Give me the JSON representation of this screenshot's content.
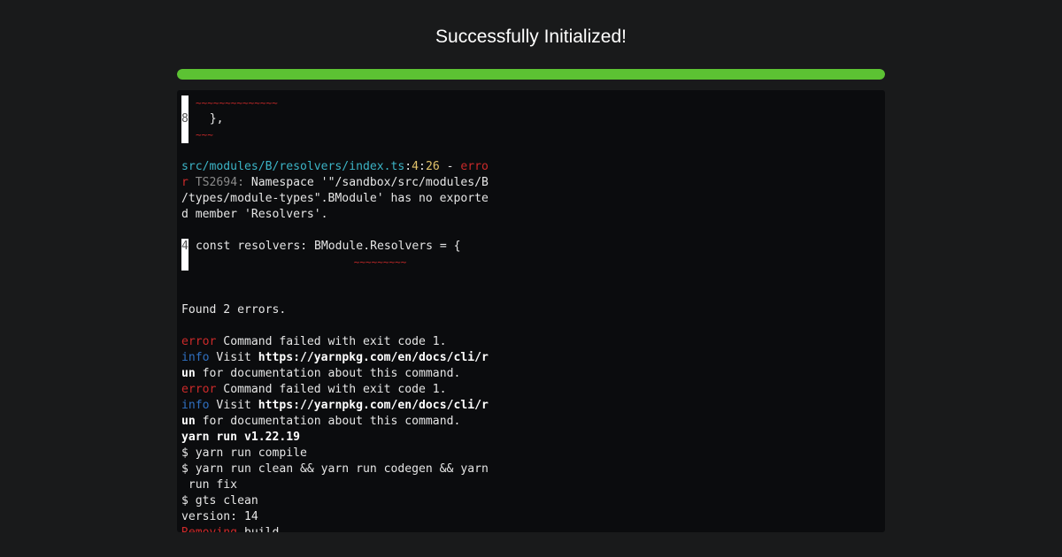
{
  "page": {
    "title": "Successfully Initialized!"
  },
  "progress": {
    "percent": 100,
    "color": "#5cc233"
  },
  "terminal": {
    "lines": [
      {
        "gutter": " ",
        "segments": [
          {
            "t": "~~~~~~~~~~~~~~",
            "c": "squig"
          }
        ]
      },
      {
        "gutter": "8",
        "segments": [
          {
            "t": "  },",
            "c": ""
          }
        ]
      },
      {
        "gutter": " ",
        "segments": [
          {
            "t": "~~~",
            "c": "squig"
          }
        ]
      },
      {
        "segments": [
          {
            "t": "",
            "c": ""
          }
        ]
      },
      {
        "segments": [
          {
            "t": "src/modules/B/resolvers/index.ts",
            "c": "cyan"
          },
          {
            "t": ":",
            "c": ""
          },
          {
            "t": "4",
            "c": "yellow"
          },
          {
            "t": ":",
            "c": ""
          },
          {
            "t": "26",
            "c": "yellow"
          },
          {
            "t": " - ",
            "c": ""
          },
          {
            "t": "erro",
            "c": "red"
          }
        ]
      },
      {
        "segments": [
          {
            "t": "r",
            "c": "red"
          },
          {
            "t": " TS2694:",
            "c": "grey"
          },
          {
            "t": " Namespace '\"/sandbox/src/modules/B",
            "c": ""
          }
        ]
      },
      {
        "segments": [
          {
            "t": "/types/module-types\".BModule' has no exporte",
            "c": ""
          }
        ]
      },
      {
        "segments": [
          {
            "t": "d member 'Resolvers'.",
            "c": ""
          }
        ]
      },
      {
        "segments": [
          {
            "t": "",
            "c": ""
          }
        ]
      },
      {
        "gutter": "4",
        "segments": [
          {
            "t": "const resolvers: BModule.Resolvers = {",
            "c": ""
          }
        ]
      },
      {
        "gutter": " ",
        "segments": [
          {
            "t": "                           ~~~~~~~~~",
            "c": "squig"
          }
        ]
      },
      {
        "segments": [
          {
            "t": "",
            "c": ""
          }
        ]
      },
      {
        "segments": [
          {
            "t": "",
            "c": ""
          }
        ]
      },
      {
        "segments": [
          {
            "t": "Found 2 errors.",
            "c": ""
          }
        ]
      },
      {
        "segments": [
          {
            "t": "",
            "c": ""
          }
        ]
      },
      {
        "segments": [
          {
            "t": "error",
            "c": "red"
          },
          {
            "t": " Command failed with exit code 1.",
            "c": ""
          }
        ]
      },
      {
        "segments": [
          {
            "t": "info",
            "c": "blue"
          },
          {
            "t": " Visit ",
            "c": ""
          },
          {
            "t": "https://yarnpkg.com/en/docs/cli/r",
            "c": "bold"
          }
        ]
      },
      {
        "segments": [
          {
            "t": "un",
            "c": "bold"
          },
          {
            "t": " for documentation about this command.",
            "c": ""
          }
        ]
      },
      {
        "segments": [
          {
            "t": "error",
            "c": "red"
          },
          {
            "t": " Command failed with exit code 1.",
            "c": ""
          }
        ]
      },
      {
        "segments": [
          {
            "t": "info",
            "c": "blue"
          },
          {
            "t": " Visit ",
            "c": ""
          },
          {
            "t": "https://yarnpkg.com/en/docs/cli/r",
            "c": "bold"
          }
        ]
      },
      {
        "segments": [
          {
            "t": "un",
            "c": "bold"
          },
          {
            "t": " for documentation about this command.",
            "c": ""
          }
        ]
      },
      {
        "segments": [
          {
            "t": "yarn run v1.22.19",
            "c": "bold"
          }
        ]
      },
      {
        "segments": [
          {
            "t": "$ yarn run compile",
            "c": ""
          }
        ]
      },
      {
        "segments": [
          {
            "t": "$ yarn run clean && yarn run codegen && yarn",
            "c": ""
          }
        ]
      },
      {
        "segments": [
          {
            "t": " run fix",
            "c": ""
          }
        ]
      },
      {
        "segments": [
          {
            "t": "$ gts clean",
            "c": ""
          }
        ]
      },
      {
        "segments": [
          {
            "t": "version: 14",
            "c": ""
          }
        ]
      },
      {
        "segments": [
          {
            "t": "Removing",
            "c": "red"
          },
          {
            "t": " build",
            "c": ""
          }
        ]
      }
    ]
  }
}
